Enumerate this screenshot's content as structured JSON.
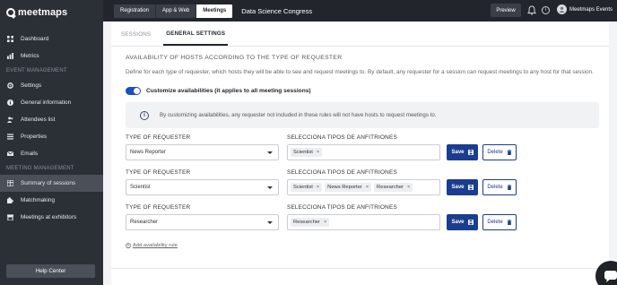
{
  "brand": {
    "name": "meetmaps"
  },
  "sidebar": {
    "items_top": [
      {
        "label": "Dashboard",
        "icon": "grid-icon"
      },
      {
        "label": "Metrics",
        "icon": "chart-icon"
      }
    ],
    "section_event": "EVENT MANAGEMENT",
    "items_event": [
      {
        "label": "Settings",
        "icon": "gear-icon"
      },
      {
        "label": "General information",
        "icon": "info-icon"
      },
      {
        "label": "Attendees list",
        "icon": "people-icon"
      },
      {
        "label": "Properties",
        "icon": "list-icon"
      },
      {
        "label": "Emails",
        "icon": "mail-icon"
      }
    ],
    "section_meeting": "MEETING MANAGEMENT",
    "items_meeting": [
      {
        "label": "Summary of sessions",
        "icon": "table-icon",
        "active": true
      },
      {
        "label": "Matchmaking",
        "icon": "puzzle-icon"
      },
      {
        "label": "Meetings at exhibitors",
        "icon": "store-icon"
      }
    ],
    "help_label": "Help Center"
  },
  "topbar": {
    "tabs": [
      {
        "label": "Registration",
        "active": false
      },
      {
        "label": "App & Web",
        "active": false
      },
      {
        "label": "Meetings",
        "active": true
      }
    ],
    "event_name": "Data Science Congress",
    "preview_label": "Preview",
    "user_name": "Meetmaps Events"
  },
  "content": {
    "subtabs": [
      {
        "label": "SESSIONS",
        "active": false
      },
      {
        "label": "GENERAL SETTINGS",
        "active": true
      }
    ],
    "section_title": "AVAILABILITY OF HOSTS ACCORDING TO THE TYPE OF REQUESTER",
    "section_desc": "Define for each type of requester, which hosts they will be able to see and request meetings to. By default, any requester for a session can request meetings to any host for that session.",
    "toggle_label": "Customize availabilities (it applies to all meeting sessions)",
    "toggle_on": true,
    "notice_text": "By customizing availabilities, any requester not included in these rules will not have hosts to request meetings to.",
    "requester_label": "TYPE OF REQUESTER",
    "hosts_label": "SELECCIONA TIPOS DE ANFITRIONES",
    "save_label": "Save",
    "delete_label": "Delete",
    "rules": [
      {
        "requester": "News Reporter",
        "hosts": [
          "Scientist"
        ]
      },
      {
        "requester": "Scientist",
        "hosts": [
          "Scientist",
          "News Reporter",
          "Researcher"
        ]
      },
      {
        "requester": "Researcher",
        "hosts": [
          "Researcher"
        ]
      }
    ],
    "add_rule_label": "Add availability rule",
    "chip_remove": "×"
  },
  "colors": {
    "accent": "#1b3d8f",
    "toggle": "#1b4fbf",
    "sidebar_bg": "#2b2f36"
  }
}
